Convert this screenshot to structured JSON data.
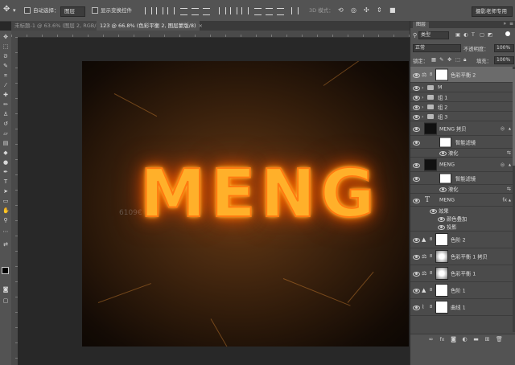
{
  "options_bar": {
    "auto_select_label": "自动选择：",
    "auto_select_value": "图层",
    "show_transform_label": "显示变换控件",
    "mode_3d_label": "3D 模式：",
    "workspace_label": "摄影老师专用"
  },
  "tabs": [
    {
      "label": "未标题-1 @ 63.6% (图层 2, RGB/8#)",
      "close": "×"
    },
    {
      "label": "123 @ 66.8% (色彩平衡 2, 图层蒙版/8)",
      "close": "×"
    }
  ],
  "canvas": {
    "title_text": "MENG",
    "watermark": "6109€"
  },
  "layers_panel": {
    "title": "图层",
    "filter_kind": "类型",
    "blend_mode": "正常",
    "opacity_label": "不透明度：",
    "opacity_value": "100%",
    "lock_label": "锁定：",
    "fill_label": "填充：",
    "fill_value": "100%",
    "layers": [
      {
        "name": "色彩平衡 2",
        "kind": "balance-adjust",
        "selected": true
      },
      {
        "name": "M",
        "kind": "group"
      },
      {
        "name": "组 1",
        "kind": "group"
      },
      {
        "name": "组 2",
        "kind": "group"
      },
      {
        "name": "组 3",
        "kind": "group"
      },
      {
        "name": "MENG 拷贝",
        "kind": "smart-object"
      },
      {
        "name": "智能滤镜",
        "kind": "smart-filter"
      },
      {
        "name": "液化",
        "kind": "filter-item"
      },
      {
        "name": "MENG",
        "kind": "smart-object"
      },
      {
        "name": "智能滤镜",
        "kind": "smart-filter"
      },
      {
        "name": "液化",
        "kind": "filter-item"
      },
      {
        "name": "MENG",
        "kind": "text"
      },
      {
        "name": "效果",
        "kind": "effects"
      },
      {
        "name": "颜色叠加",
        "kind": "effect-item"
      },
      {
        "name": "投影",
        "kind": "effect-item"
      },
      {
        "name": "色阶 2",
        "kind": "levels-adjust"
      },
      {
        "name": "色彩平衡 1 拷贝",
        "kind": "balance-adjust"
      },
      {
        "name": "色彩平衡 1",
        "kind": "balance-adjust"
      },
      {
        "name": "色阶 1",
        "kind": "levels-adjust"
      },
      {
        "name": "曲线 1",
        "kind": "curves-adjust"
      }
    ],
    "footer_icons": [
      "link-icon",
      "fx-icon",
      "mask-icon",
      "adjustment-icon",
      "folder-icon",
      "new-layer-icon",
      "trash-icon"
    ]
  },
  "colors": {
    "fire_core": "#ffb02a",
    "fire_glow": "#ff5a00",
    "panel_bg": "#535353",
    "selected_layer": "#6b6b6b"
  }
}
